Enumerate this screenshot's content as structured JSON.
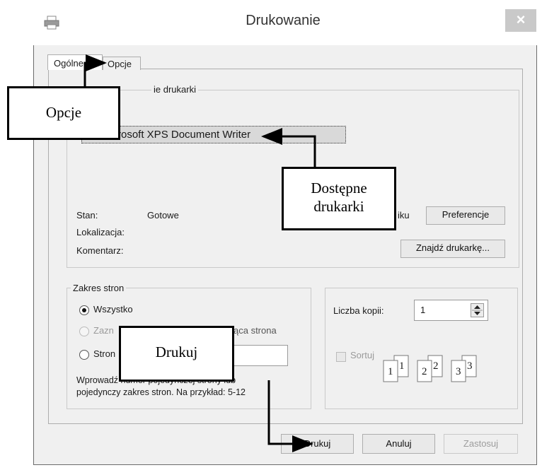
{
  "window": {
    "title": "Drukowanie",
    "close_glyph": "×"
  },
  "tabs": [
    {
      "label": "Ogólne"
    },
    {
      "label": "Opcje"
    }
  ],
  "printer_group": {
    "label_visible": "ie drukarki",
    "selected_printer": "rosoft XPS Document Writer",
    "status_label": "Stan:",
    "status_value": "Gotowe",
    "location_label": "Lokalizacja:",
    "comment_label": "Komentarz:",
    "to_file_fragment": "iku",
    "preferences_button": "Preferencje",
    "find_printer_button": "Znajdź drukarkę..."
  },
  "page_range": {
    "label": "Zakres stron",
    "all": "Wszystko",
    "selection_fragment": "Zazn",
    "current_page_fragment": "ąca strona",
    "pages_fragment": "Stron",
    "hint_line1": "Wprowadź numer pojedynczej strony lub",
    "hint_line2": "pojedynczy zakres stron. Na przykład: 5-12"
  },
  "copies": {
    "label": "Liczba kopii:",
    "value": "1",
    "collate_label": "Sortuj",
    "collate_icons": [
      "1",
      "1",
      "2",
      "2",
      "3",
      "3"
    ]
  },
  "buttons": {
    "print": "Drukuj",
    "cancel": "Anuluj",
    "apply": "Zastosuj"
  },
  "callouts": {
    "options": "Opcje",
    "printers_line1": "Dostępne",
    "printers_line2": "drukarki",
    "print": "Drukuj"
  },
  "icons": {
    "printer": "printer-icon",
    "spin": "spinner-icon"
  }
}
